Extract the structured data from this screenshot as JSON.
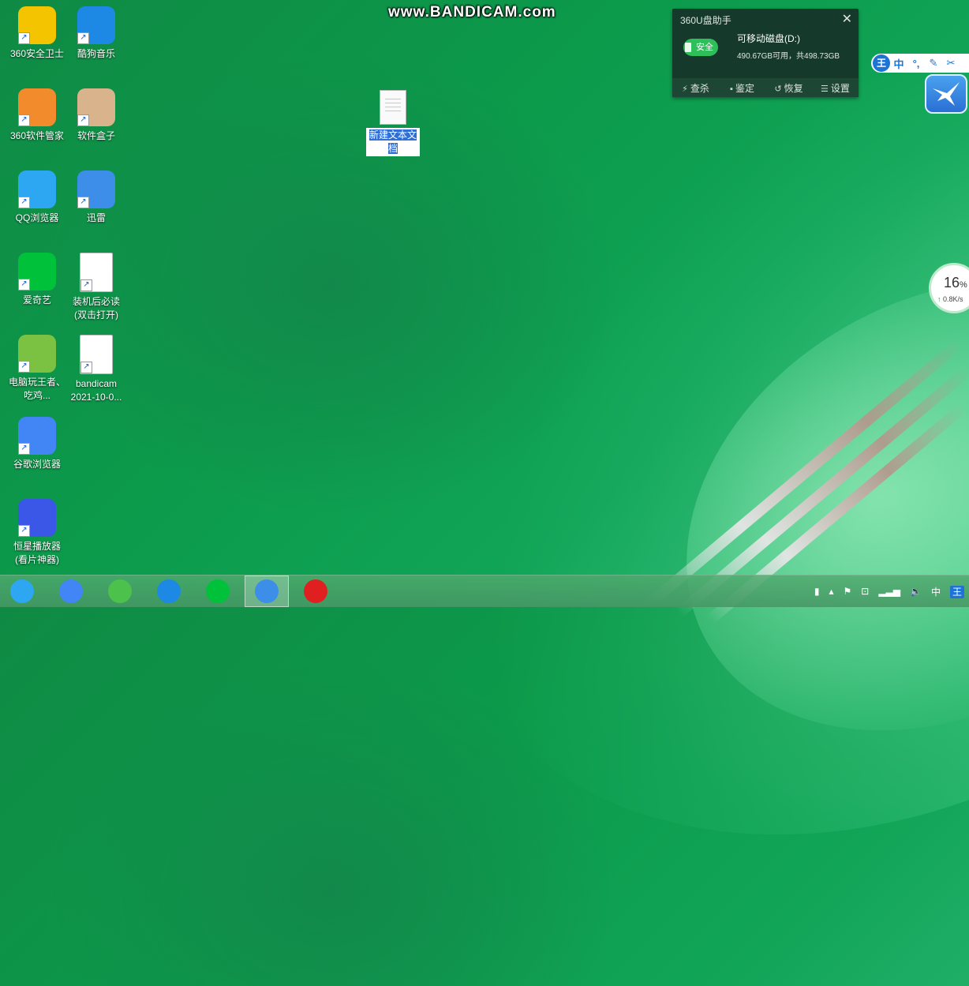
{
  "watermark": "www.BANDICAM.com",
  "desktop_icons": [
    {
      "label": "360安全卫士",
      "icon": "360-safe-icon",
      "color": "#f5c400"
    },
    {
      "label": "酷狗音乐",
      "icon": "kugou-icon",
      "color": "#1e88e5"
    },
    {
      "label": "360软件管家",
      "icon": "360-software-manager-icon",
      "color": "#f28b2c"
    },
    {
      "label": "软件盒子",
      "icon": "software-box-icon",
      "color": "#d9b38c"
    },
    {
      "label": "QQ浏览器",
      "icon": "qq-browser-icon",
      "color": "#2ea7f2"
    },
    {
      "label": "迅雷",
      "icon": "xunlei-icon",
      "color": "#3c8ee8"
    },
    {
      "label": "爱奇艺",
      "icon": "iqiyi-icon",
      "color": "#00c13a"
    },
    {
      "label": "装机后必读(双击打开)",
      "icon": "word-doc-icon",
      "color": "#ffffff"
    },
    {
      "label": "电脑玩王者、吃鸡...",
      "icon": "bluestacks-icon",
      "color": "#7cc242"
    },
    {
      "label": "bandicam 2021-10-0...",
      "icon": "video-file-icon",
      "color": "#ffffff"
    },
    {
      "label": "谷歌浏览器",
      "icon": "chrome-icon",
      "color": "#4285f4"
    },
    {
      "label": "恒星播放器(看片神器)",
      "icon": "hengxing-player-icon",
      "color": "#3a57e8"
    }
  ],
  "selected_file": {
    "label": "新建文本文档",
    "icon": "text-file-icon"
  },
  "usb_popup": {
    "title": "360U盘助手",
    "badge": "安全",
    "drive_name": "可移动磁盘(D:)",
    "drive_info": "490.67GB可用，共498.73GB",
    "actions": [
      {
        "label": "查杀",
        "icon": "lightning-icon"
      },
      {
        "label": "鉴定",
        "icon": "drive-icon"
      },
      {
        "label": "恢复",
        "icon": "restore-icon"
      },
      {
        "label": "设置",
        "icon": "list-icon"
      }
    ]
  },
  "ime_bar": {
    "logo": "王",
    "mode": "中",
    "items": [
      "°,",
      "✎",
      "✂"
    ]
  },
  "net_widget": {
    "percent": "16",
    "percent_unit": "%",
    "speed": "0.8K/s"
  },
  "taskbar": {
    "apps": [
      {
        "name": "qq-browser-icon",
        "color": "#2ea7f2"
      },
      {
        "name": "chrome-icon",
        "color": "#4285f4"
      },
      {
        "name": "360-browser-icon",
        "color": "#4cc24c"
      },
      {
        "name": "kugou-icon",
        "color": "#1e88e5"
      },
      {
        "name": "iqiyi-icon",
        "color": "#00c13a"
      },
      {
        "name": "xunlei-icon",
        "color": "#3c8ee8",
        "active": true
      },
      {
        "name": "bandicam-record-icon",
        "color": "#e02020"
      }
    ],
    "tray": {
      "ime": "中",
      "ime_logo": "王"
    }
  }
}
